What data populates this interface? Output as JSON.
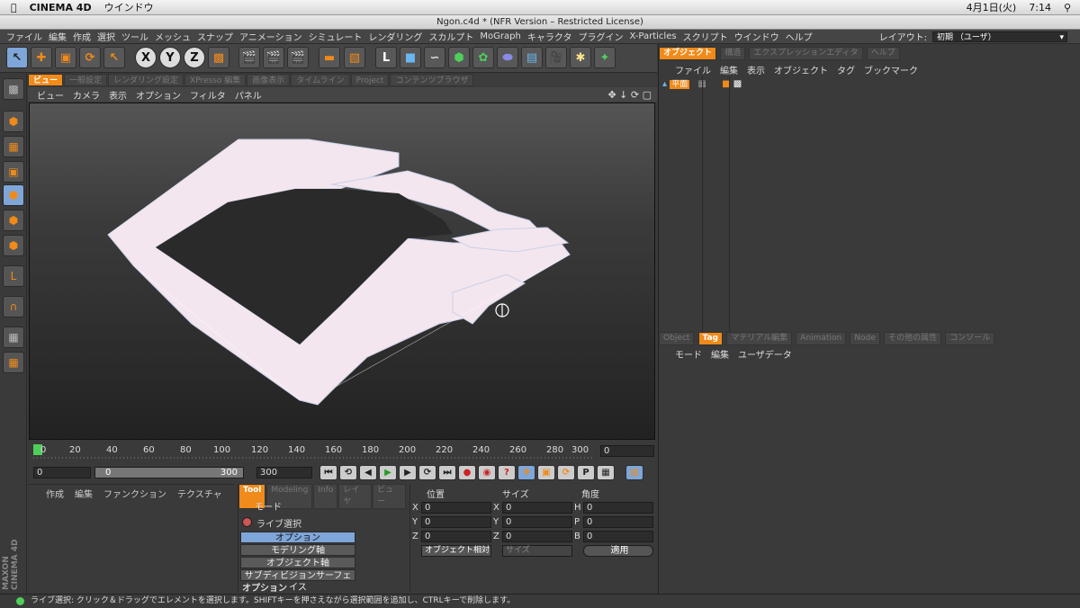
{
  "mac_menu": {
    "app": "CINEMA 4D",
    "window_menu": "ウインドウ",
    "date": "4月1日(火)",
    "time": "7:14"
  },
  "window_title": "Ngon.c4d * (NFR Version – Restricted License)",
  "menus": [
    "ファイル",
    "編集",
    "作成",
    "選択",
    "ツール",
    "メッシュ",
    "スナップ",
    "アニメーション",
    "シミュレート",
    "レンダリング",
    "スカルプト",
    "MoGraph",
    "キャラクタ",
    "プラグイン",
    "X-Particles",
    "スクリプト",
    "ウインドウ",
    "ヘルプ"
  ],
  "layout_label": "レイアウト:",
  "layout_value": "初期 （ユーザ）",
  "axis_buttons": [
    "X",
    "Y",
    "Z"
  ],
  "viewport_tabs": [
    "ビュー",
    "一般設定",
    "レンダリング設定",
    "XPresso 編集",
    "画像表示",
    "タイムライン",
    "Project",
    "コンテンツブラウザ"
  ],
  "viewport_menu": [
    "ビュー",
    "カメラ",
    "表示",
    "オプション",
    "フィルタ",
    "パネル"
  ],
  "timeline_ticks": [
    "0",
    "20",
    "40",
    "60",
    "80",
    "100",
    "120",
    "140",
    "160",
    "180",
    "200",
    "220",
    "240",
    "260",
    "280",
    "300"
  ],
  "current_frame": "0",
  "transport": {
    "start": "0",
    "range_start": "0",
    "range_end": "300",
    "end": "300"
  },
  "material_menu": [
    "作成",
    "編集",
    "ファンクション",
    "テクスチャ"
  ],
  "tool_tabs": [
    "Tool",
    "Modeling",
    "Info",
    "レイヤ",
    "ビュー"
  ],
  "tool_mode": "モード",
  "tool_name": "ライブ選択",
  "tool_buttons": [
    "オプション",
    "モデリング軸",
    "オブジェクト軸",
    "サブディビジョンサーフェイス"
  ],
  "tool_section": "オプション",
  "coord_headers": [
    "位置",
    "サイズ",
    "角度"
  ],
  "coords": {
    "pos": [
      {
        "axis": "X",
        "value": "0"
      },
      {
        "axis": "Y",
        "value": "0"
      },
      {
        "axis": "Z",
        "value": "0"
      }
    ],
    "size": [
      {
        "axis": "X",
        "value": "0"
      },
      {
        "axis": "Y",
        "value": "0"
      },
      {
        "axis": "Z",
        "value": "0"
      }
    ],
    "rot": [
      {
        "axis": "H",
        "value": "0"
      },
      {
        "axis": "P",
        "value": "0"
      },
      {
        "axis": "B",
        "value": "0"
      }
    ]
  },
  "coord_mode": "オブジェクト相対",
  "coord_size_mode": "サイズ",
  "apply_button": "適用",
  "object_tabs": [
    "オブジェクト",
    "構造",
    "エクスプレッションエディタ",
    "ヘルプ"
  ],
  "object_menu": [
    "ファイル",
    "編集",
    "表示",
    "オブジェクト",
    "タグ",
    "ブックマーク"
  ],
  "object_item": "平面",
  "attr_tabs": [
    "Object",
    "Tag",
    "マテリアル編集",
    "Animation",
    "Node",
    "その他の属性",
    "コンソール"
  ],
  "attr_menu": [
    "モード",
    "編集",
    "ユーザデータ"
  ],
  "status_text": "ライブ選択: クリック＆ドラッグでエレメントを選択します。SHIFTキーを押さえながら選択範囲を追加し、CTRLキーで削除します。",
  "brand": "MAXON CINEMA 4D",
  "colors": {
    "accent": "#f08a1a",
    "selection": "#7ea6d8",
    "mesh": "#f4e6ee"
  }
}
